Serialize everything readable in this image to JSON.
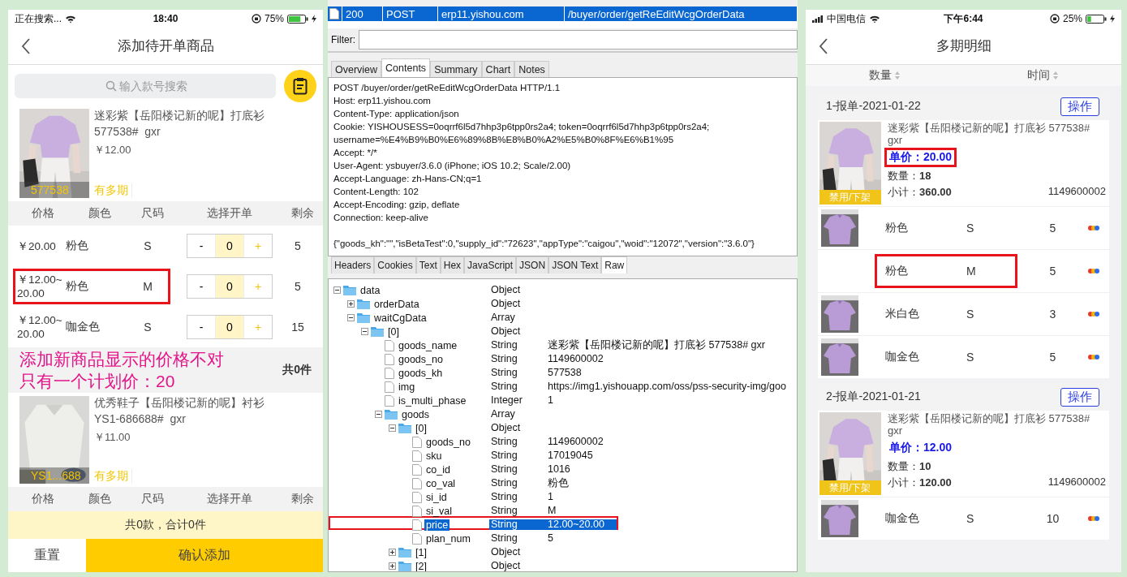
{
  "left_phone": {
    "status_bar": {
      "carrier": "正在搜索...",
      "time": "18:40",
      "battery": "75%"
    },
    "nav": {
      "title": "添加待开单商品"
    },
    "search": {
      "placeholder": "输入款号搜索"
    },
    "products": [
      {
        "name": "迷彩紫【岳阳楼记新的呢】打底衫",
        "code": "577538#  gxr",
        "price": "￥12.00",
        "image_label": "577538",
        "tag": "有多期",
        "columns": [
          "价格",
          "颜色",
          "尺码",
          "选择开单",
          "剩余"
        ],
        "rows": [
          {
            "price": "￥20.00",
            "color_name": "粉色",
            "size": "S",
            "minus": "-",
            "quantity": "0",
            "plus": "+",
            "remaining": "5",
            "annotated": false
          },
          {
            "price": "￥12.00~20.00",
            "color_name": "粉色",
            "size": "M",
            "minus": "-",
            "quantity": "0",
            "plus": "+",
            "remaining": "5",
            "annotated": true
          },
          {
            "price": "￥12.00~20.00",
            "color_name": "咖金色",
            "size": "S",
            "minus": "-",
            "quantity": "0",
            "plus": "+",
            "remaining": "15",
            "annotated": false
          }
        ],
        "note": [
          "添加新商品显示的价格不对",
          "只有一个计划价：20"
        ],
        "total": "共0件"
      },
      {
        "name": "优秀鞋子【岳阳楼记新的呢】衬衫",
        "code": "YS1-686688#  gxr",
        "price": "￥11.00",
        "image_label": "YS1...688",
        "tag": "有多期",
        "columns": [
          "价格",
          "颜色",
          "尺码",
          "选择开单",
          "剩余"
        ]
      }
    ],
    "summary": "共0款，合计0件",
    "buttons": [
      {
        "label": "重置",
        "kind": "secondary"
      },
      {
        "label": "确认添加",
        "kind": "primary"
      }
    ]
  },
  "fiddler": {
    "sessions": [
      {
        "status": "200",
        "method": "POST",
        "host": "erp11.yishou.com",
        "url": "/buyer/order/getReEditWcgOrderData",
        "selected": true
      }
    ],
    "filter": {
      "label": "Filter:"
    },
    "tabs": [
      {
        "label": "Overview",
        "selected": false
      },
      {
        "label": "Contents",
        "selected": true
      },
      {
        "label": "Summary",
        "selected": false
      },
      {
        "label": "Chart",
        "selected": false
      },
      {
        "label": "Notes",
        "selected": false
      }
    ],
    "request_lines": [
      "POST /buyer/order/getReEditWcgOrderData HTTP/1.1",
      "Host: erp11.yishou.com",
      "Content-Type: application/json",
      "Cookie: YISHOUSESS=0oqrrf6l5d7hhp3p6tpp0rs2a4; token=0oqrrf6l5d7hhp3p6tpp0rs2a4;",
      "username=%E4%B9%B0%E6%89%8B%E8%B0%A2%E5%B0%8F%E6%B1%95",
      "Accept: */*",
      "User-Agent: ysbuyer/3.6.0 (iPhone; iOS 10.2; Scale/2.00)",
      "Accept-Language: zh-Hans-CN;q=1",
      "Content-Length: 102",
      "Accept-Encoding: gzip, deflate",
      "Connection: keep-alive"
    ],
    "body": "{\"goods_kh\":\"\",\"isBetaTest\":0,\"supply_id\":\"72623\",\"appType\":\"caigou\",\"woid\":\"12072\",\"version\":\"3.6.0\"}",
    "view_tabs": [
      {
        "label": "Headers",
        "selected": false
      },
      {
        "label": "Cookies",
        "selected": false
      },
      {
        "label": "Text",
        "selected": false
      },
      {
        "label": "Hex",
        "selected": false
      },
      {
        "label": "JavaScript",
        "selected": false
      },
      {
        "label": "JSON",
        "selected": false
      },
      {
        "label": "JSON Text",
        "selected": false
      },
      {
        "label": "Raw",
        "selected": true
      }
    ],
    "tree": [
      {
        "name": "data",
        "type": "Object",
        "kind": "folder",
        "expanded": true,
        "selected": false,
        "annotated": false,
        "children": [
          {
            "name": "orderData",
            "type": "Object",
            "kind": "folder",
            "expanded": false,
            "selected": false,
            "annotated": false
          },
          {
            "name": "waitCgData",
            "type": "Array",
            "kind": "folder",
            "expanded": true,
            "selected": false,
            "annotated": false,
            "children": [
              {
                "name": "[0]",
                "type": "Object",
                "kind": "folder",
                "expanded": true,
                "selected": false,
                "annotated": false,
                "children": [
                  {
                    "name": "goods_name",
                    "type": "String",
                    "value": "迷彩紫【岳阳楼记新的呢】打底衫  577538#  gxr",
                    "kind": "field",
                    "selected": false,
                    "annotated": false
                  },
                  {
                    "name": "goods_no",
                    "type": "String",
                    "value": "1149600002",
                    "kind": "field",
                    "selected": false,
                    "annotated": false
                  },
                  {
                    "name": "goods_kh",
                    "type": "String",
                    "value": "577538",
                    "kind": "field",
                    "selected": false,
                    "annotated": false
                  },
                  {
                    "name": "img",
                    "type": "String",
                    "value": "https://img1.yishouapp.com/oss/pss-security-img/goo",
                    "kind": "field",
                    "selected": false,
                    "annotated": false
                  },
                  {
                    "name": "is_multi_phase",
                    "type": "Integer",
                    "value": "1",
                    "kind": "field",
                    "selected": false,
                    "annotated": false
                  },
                  {
                    "name": "goods",
                    "type": "Array",
                    "kind": "folder",
                    "expanded": true,
                    "selected": false,
                    "annotated": false,
                    "children": [
                      {
                        "name": "[0]",
                        "type": "Object",
                        "kind": "folder",
                        "expanded": true,
                        "selected": false,
                        "annotated": false,
                        "children": [
                          {
                            "name": "goods_no",
                            "type": "String",
                            "value": "1149600002",
                            "kind": "field",
                            "selected": false,
                            "annotated": false
                          },
                          {
                            "name": "sku",
                            "type": "String",
                            "value": "17019045",
                            "kind": "field",
                            "selected": false,
                            "annotated": false
                          },
                          {
                            "name": "co_id",
                            "type": "String",
                            "value": "1016",
                            "kind": "field",
                            "selected": false,
                            "annotated": false
                          },
                          {
                            "name": "co_val",
                            "type": "String",
                            "value": "粉色",
                            "kind": "field",
                            "selected": false,
                            "annotated": false
                          },
                          {
                            "name": "si_id",
                            "type": "String",
                            "value": "1",
                            "kind": "field",
                            "selected": false,
                            "annotated": false
                          },
                          {
                            "name": "si_val",
                            "type": "String",
                            "value": "M",
                            "kind": "field",
                            "selected": false,
                            "annotated": false
                          },
                          {
                            "name": "price",
                            "type": "String",
                            "value": "12.00~20.00",
                            "kind": "field",
                            "selected": true,
                            "annotated": true
                          },
                          {
                            "name": "plan_num",
                            "type": "String",
                            "value": "5",
                            "kind": "field",
                            "selected": false,
                            "annotated": false
                          }
                        ]
                      },
                      {
                        "name": "[1]",
                        "type": "Object",
                        "kind": "folder",
                        "expanded": false,
                        "selected": false,
                        "annotated": false
                      },
                      {
                        "name": "[2]",
                        "type": "Object",
                        "kind": "folder",
                        "expanded": false,
                        "selected": false,
                        "annotated": false
                      }
                    ]
                  }
                ]
              }
            ]
          }
        ]
      }
    ]
  },
  "right_phone": {
    "status_bar": {
      "carrier": "中国电信",
      "time": "下午6:44",
      "battery": "25%"
    },
    "nav": {
      "title": "多期明细"
    },
    "sort_headers": [
      "数量",
      "时间"
    ],
    "groups": [
      {
        "title": "1-报单-2021-01-22",
        "action": "操作",
        "product": {
          "name": "迷彩紫【岳阳楼记新的呢】打底衫  577538# gxr",
          "image_label": "禁用/下架",
          "unit_price": "单价：20.00",
          "price_annotated": true,
          "quantity": "数量：**18**",
          "subtotal": "小计：**360.00**",
          "goods_no": "1149600002"
        },
        "variants": [
          {
            "color_name": "粉色",
            "size": "S",
            "qty": "5",
            "thumbnail": true,
            "annotated": false
          },
          {
            "color_name": "粉色",
            "size": "M",
            "qty": "5",
            "thumbnail": false,
            "annotated": true
          },
          {
            "color_name": "米白色",
            "size": "S",
            "qty": "3",
            "thumbnail": true,
            "annotated": false
          },
          {
            "color_name": "咖金色",
            "size": "S",
            "qty": "5",
            "thumbnail": true,
            "annotated": false
          }
        ]
      },
      {
        "title": "2-报单-2021-01-21",
        "action": "操作",
        "product": {
          "name": "迷彩紫【岳阳楼记新的呢】打底衫  577538# gxr",
          "image_label": "禁用/下架",
          "unit_price": "单价：12.00",
          "price_annotated": false,
          "quantity": "数量：**10**",
          "subtotal": "小计：**120.00**",
          "goods_no": "1149600002"
        },
        "variants": [
          {
            "color_name": "咖金色",
            "size": "S",
            "qty": "10",
            "thumbnail": true,
            "annotated": false
          }
        ]
      }
    ]
  }
}
